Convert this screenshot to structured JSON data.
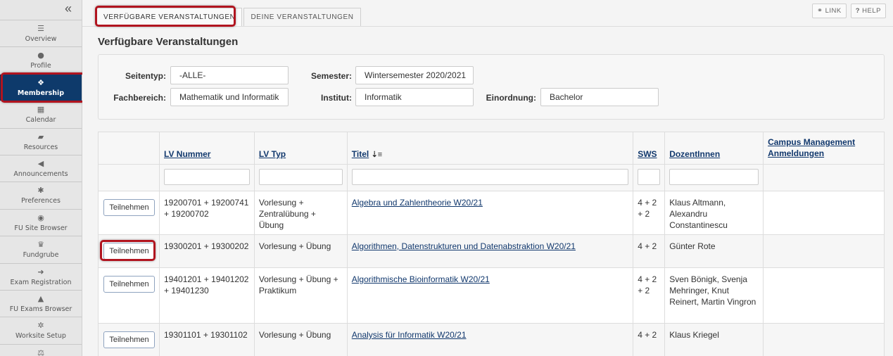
{
  "sidebar": {
    "collapse_icon": "double-chevron-left-icon",
    "items": [
      {
        "label": "Overview",
        "icon": "list-icon",
        "glyph": "☰"
      },
      {
        "label": "Profile",
        "icon": "user-icon",
        "glyph": "●"
      },
      {
        "label": "Membership",
        "icon": "users-icon",
        "glyph": "❖"
      },
      {
        "label": "Calendar",
        "icon": "calendar-icon",
        "glyph": "▦"
      },
      {
        "label": "Resources",
        "icon": "folder-icon",
        "glyph": "▰"
      },
      {
        "label": "Announcements",
        "icon": "bullhorn-icon",
        "glyph": "◀"
      },
      {
        "label": "Preferences",
        "icon": "gear-icon",
        "glyph": "✱"
      },
      {
        "label": "FU Site Browser",
        "icon": "globe-icon",
        "glyph": "◉"
      },
      {
        "label": "Fundgrube",
        "icon": "trophy-icon",
        "glyph": "♛"
      },
      {
        "label": "Exam Registration",
        "icon": "sign-in-icon",
        "glyph": "➜"
      },
      {
        "label": "FU Exams Browser",
        "icon": "graduation-cap-icon",
        "glyph": "▲"
      },
      {
        "label": "Worksite Setup",
        "icon": "gears-icon",
        "glyph": "✲"
      },
      {
        "label": "",
        "icon": "balance-scale-icon",
        "glyph": "⚖"
      }
    ],
    "active": "Membership"
  },
  "tabs": [
    {
      "label": "VERFÜGBARE VERANSTALTUNGEN",
      "active": true
    },
    {
      "label": "DEINE VERANSTALTUNGEN",
      "active": false
    }
  ],
  "top_buttons": {
    "link": {
      "label": "LINK",
      "icon": "link-icon"
    },
    "help": {
      "label": "HELP",
      "icon": "question-icon"
    }
  },
  "page_title": "Verfügbare Veranstaltungen",
  "filters": {
    "seitentyp": {
      "label": "Seitentyp:",
      "value": "-ALLE-"
    },
    "semester": {
      "label": "Semester:",
      "value": "Wintersemester 2020/2021"
    },
    "fachbereich": {
      "label": "Fachbereich:",
      "value": "Mathematik und Informatik"
    },
    "institut": {
      "label": "Institut:",
      "value": "Informatik"
    },
    "einordnung": {
      "label": "Einordnung:",
      "value": "Bachelor"
    }
  },
  "table": {
    "headers": {
      "lv_nummer": "LV Nummer",
      "lv_typ": "LV Typ",
      "titel": "Titel",
      "titel_sort_icon": "sort-amount-icon",
      "sws": "SWS",
      "dozent": "DozentInnen",
      "campus": "Campus Management Anmeldungen"
    },
    "join_label": "Teilnehmen",
    "rows": [
      {
        "nummer": "19200701 + 19200741 + 19200702",
        "typ": "Vorlesung + Zentralübung + Übung",
        "titel": "Algebra und Zahlentheorie W20/21",
        "sws": "4 + 2 + 2",
        "dozent": "Klaus Altmann, Alexandru Constantinescu",
        "campus": ""
      },
      {
        "nummer": "19300201 + 19300202",
        "typ": "Vorlesung + Übung",
        "titel": "Algorithmen, Datenstrukturen und Datenabstraktion W20/21",
        "sws": "4 + 2",
        "dozent": "Günter Rote",
        "campus": ""
      },
      {
        "nummer": "19401201 + 19401202 + 19401230",
        "typ": "Vorlesung + Übung + Praktikum",
        "titel": "Algorithmische Bioinformatik W20/21",
        "sws": "4 + 2 + 2",
        "dozent": "Sven Bönigk, Svenja Mehringer, Knut Reinert, Martin Vingron",
        "campus": ""
      },
      {
        "nummer": "19301101 + 19301102",
        "typ": "Vorlesung + Übung",
        "titel": "Analysis für Informatik W20/21",
        "sws": "4 + 2",
        "dozent": "Klaus Kriegel",
        "campus": ""
      }
    ]
  },
  "colors": {
    "active_nav": "#0e3a6b",
    "highlight": "#b1141f",
    "link": "#11386d"
  }
}
